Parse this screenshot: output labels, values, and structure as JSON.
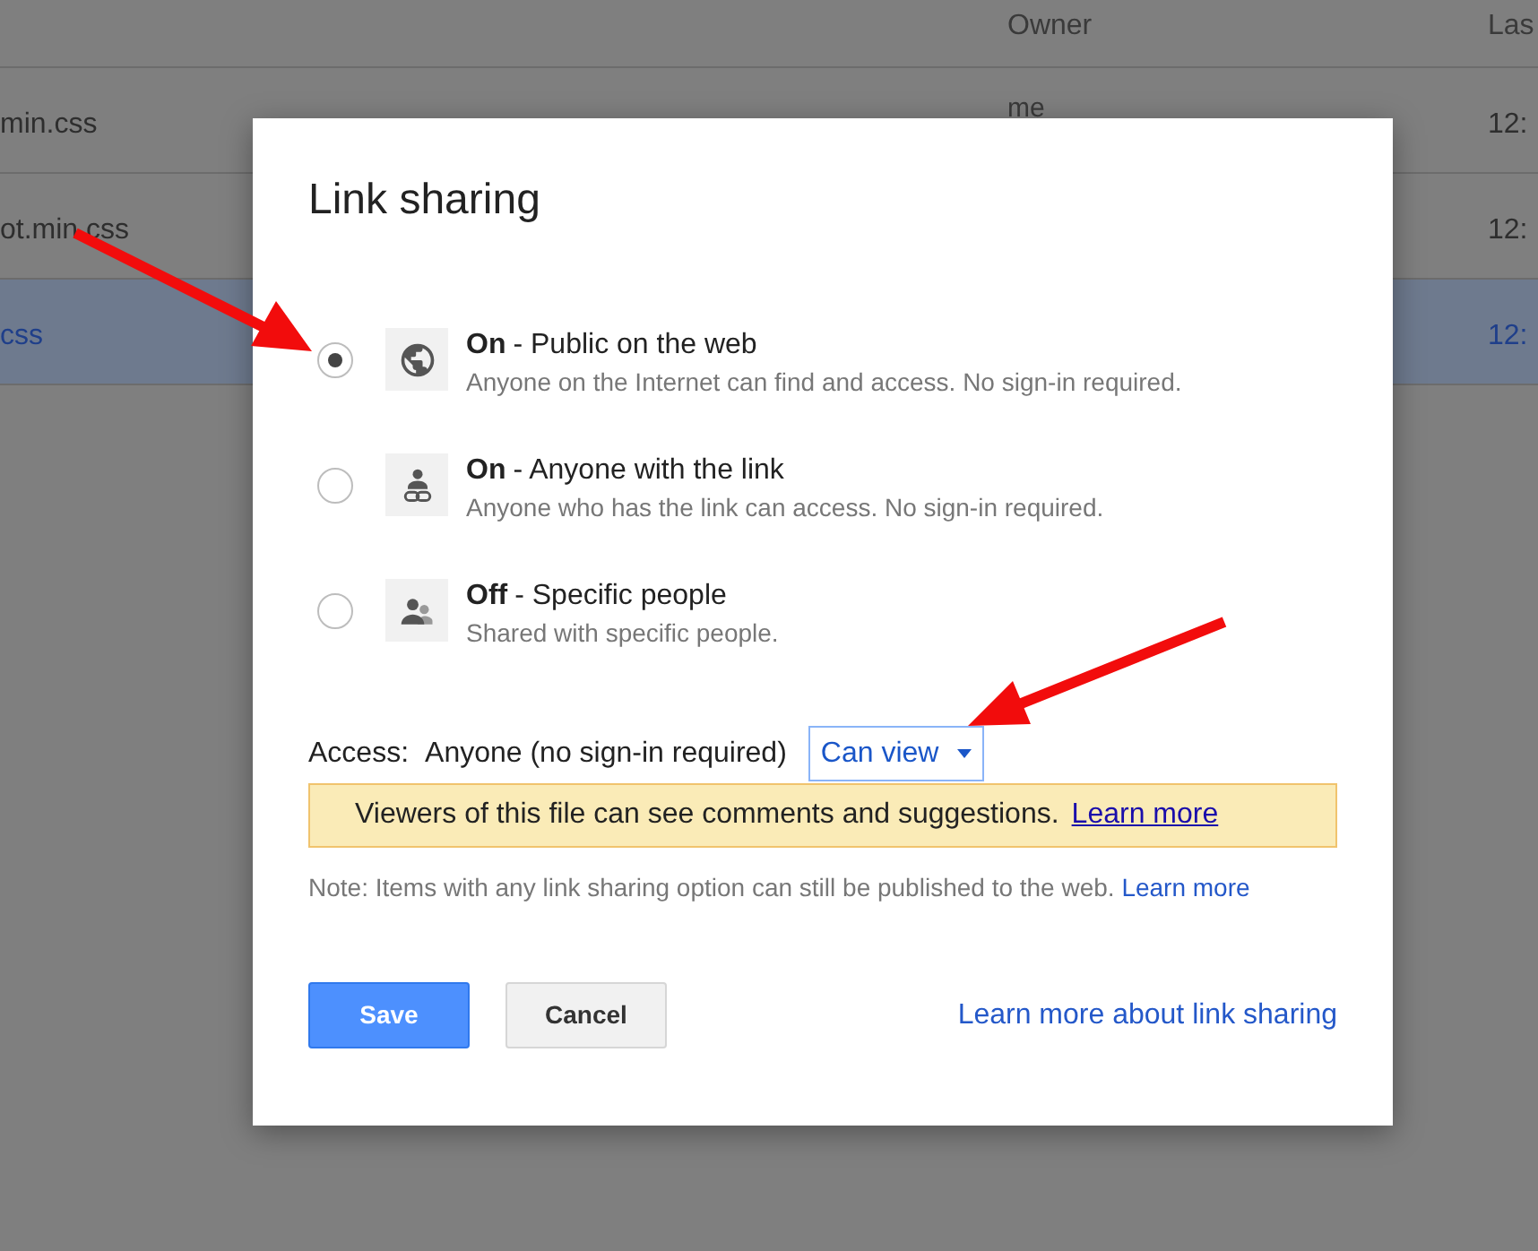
{
  "file_list": {
    "column_2": "Owner",
    "column_3": "Las",
    "rows": [
      {
        "name": "min.css",
        "owner": "me",
        "time": "12:",
        "selected": false
      },
      {
        "name": "ot.min.css",
        "time": "12:",
        "selected": false
      },
      {
        "name": "css",
        "time": "12:",
        "selected": true
      }
    ]
  },
  "dialog": {
    "title": "Link sharing",
    "options": [
      {
        "kind": "public",
        "status": "On",
        "label": "- Public on the web",
        "description": "Anyone on the Internet can find and access. No sign-in required.",
        "selected": true
      },
      {
        "kind": "link",
        "status": "On",
        "label": "- Anyone with the link",
        "description": "Anyone who has the link can access. No sign-in required.",
        "selected": false
      },
      {
        "kind": "private",
        "status": "Off",
        "label": "- Specific people",
        "description": "Shared with specific people.",
        "selected": false
      }
    ],
    "access": {
      "label": "Access:",
      "value": "Anyone (no sign-in required)",
      "dropdown": "Can view"
    },
    "notice": {
      "text": "Viewers of this file can see comments and suggestions.",
      "link": "Learn more"
    },
    "note": {
      "text": "Note: Items with any link sharing option can still be published to the web.",
      "link": "Learn more"
    },
    "buttons": [
      {
        "label": "Save",
        "kind": "primary"
      },
      {
        "label": "Cancel",
        "kind": "secondary"
      }
    ],
    "footer_link": "Learn more about link sharing"
  }
}
